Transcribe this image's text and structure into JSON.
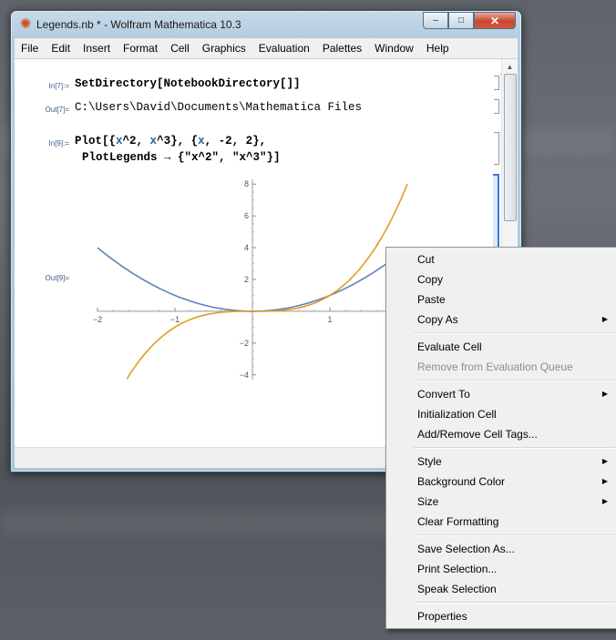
{
  "window": {
    "title": "Legends.nb * - Wolfram Mathematica 10.3",
    "app_icon": "mathematica-star-icon",
    "controls": {
      "minimize": "‒",
      "maximize": "□",
      "close": "✕"
    }
  },
  "menubar": [
    "File",
    "Edit",
    "Insert",
    "Format",
    "Cell",
    "Graphics",
    "Evaluation",
    "Palettes",
    "Window",
    "Help"
  ],
  "cells": {
    "in7_label": "In[7]:=",
    "in7_code": "SetDirectory[NotebookDirectory[]]",
    "out7_label": "Out[7]=",
    "out7_text": "C:\\Users\\David\\Documents\\Mathematica Files",
    "in9_label": "In[9]:=",
    "in9_line1_prefix": "Plot[{",
    "in9_x1": "x",
    "in9_pow1": "^2, ",
    "in9_x2": "x",
    "in9_pow2": "^3}, {",
    "in9_x3": "x",
    "in9_range": ", -2, 2},",
    "in9_line2": "PlotLegends → {\"x^2\", \"x^3\"}]",
    "out9_label": "Out[9]="
  },
  "chart_data": {
    "type": "line",
    "title": "",
    "xlabel": "",
    "ylabel": "",
    "xlim": [
      -2,
      2
    ],
    "ylim": [
      -4.3,
      8.3
    ],
    "x_ticks": [
      -2,
      -1,
      1
    ],
    "y_ticks": [
      8,
      6,
      4,
      2,
      -2,
      -4
    ],
    "x_tick_labels": [
      "−2",
      "−1",
      "1"
    ],
    "y_tick_labels": [
      "8",
      "6",
      "4",
      "2",
      "−2",
      "−4"
    ],
    "series": [
      {
        "color": "#5e81b5",
        "x": [
          -2,
          -1.5,
          -1,
          -0.5,
          0,
          0.5,
          1,
          1.5,
          2
        ],
        "values": [
          4,
          2.25,
          1,
          0.25,
          0,
          0.25,
          1,
          2.25,
          4
        ]
      },
      {
        "color": "#e19c24",
        "x": [
          -1.62,
          -1.5,
          -1,
          -0.5,
          0,
          0.5,
          1,
          1.5,
          2
        ],
        "values": [
          -4.25,
          -3.375,
          -1,
          -0.125,
          0,
          0.125,
          1,
          3.375,
          8
        ]
      }
    ]
  },
  "context_menu": {
    "groups": [
      [
        {
          "label": "Cut"
        },
        {
          "label": "Copy"
        },
        {
          "label": "Paste"
        },
        {
          "label": "Copy As",
          "submenu": true
        }
      ],
      [
        {
          "label": "Evaluate Cell"
        },
        {
          "label": "Remove from Evaluation Queue",
          "disabled": true
        }
      ],
      [
        {
          "label": "Convert To",
          "submenu": true
        },
        {
          "label": "Initialization Cell"
        },
        {
          "label": "Add/Remove Cell Tags..."
        }
      ],
      [
        {
          "label": "Style",
          "submenu": true
        },
        {
          "label": "Background Color",
          "submenu": true
        },
        {
          "label": "Size",
          "submenu": true
        },
        {
          "label": "Clear Formatting"
        }
      ],
      [
        {
          "label": "Save Selection As..."
        },
        {
          "label": "Print Selection..."
        },
        {
          "label": "Speak Selection"
        }
      ],
      [
        {
          "label": "Properties"
        }
      ]
    ],
    "submenu_arrow": "▶"
  }
}
